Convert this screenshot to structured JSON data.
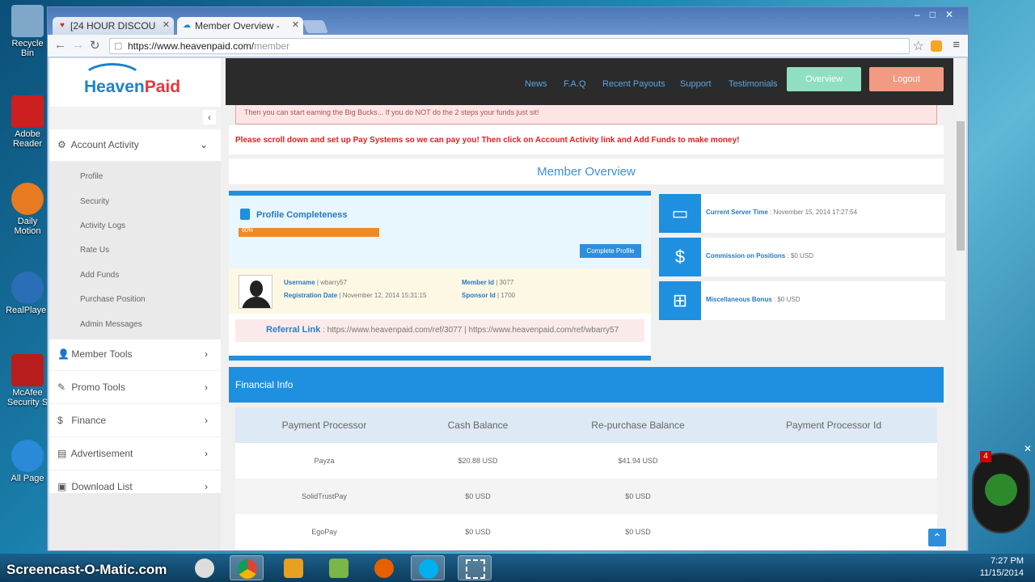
{
  "desktop": {
    "icons": [
      {
        "label": "Recycle Bin",
        "color": "#7fa7c9"
      },
      {
        "label": "Adobe Reader",
        "color": "#cc1f1f"
      },
      {
        "label": "Daily Motion",
        "color": "#e87a1f"
      },
      {
        "label": "RealPlayer",
        "color": "#2a6fb5"
      },
      {
        "label": "McAfee Security S",
        "color": "#b81d1d"
      },
      {
        "label": "All Page",
        "color": "#2a8ad8"
      }
    ]
  },
  "browser": {
    "tabs": [
      {
        "label": "[24 HOUR DISCOU",
        "icon": "heart-icon"
      },
      {
        "label": "Member Overview - ",
        "icon": "heavenpaid-favicon"
      }
    ],
    "url_host": "https://www.heavenpaid.com/",
    "url_path": "member"
  },
  "site": {
    "logo_a": "Heaven",
    "logo_b": "Paid",
    "nav": [
      "News",
      "F.A.Q",
      "Recent Payouts",
      "Support",
      "Testimonials"
    ],
    "overview_btn": "Overview",
    "logout_btn": "Logout"
  },
  "sidebar": {
    "collapse_arrow": "‹",
    "account_activity": "Account Activity",
    "submenu": [
      "Profile",
      "Security",
      "Activity Logs",
      "Rate Us",
      "Add Funds",
      "Purchase Position",
      "Admin Messages"
    ],
    "items": [
      "Member Tools",
      "Promo Tools",
      "Finance",
      "Advertisement",
      "Download List"
    ]
  },
  "main": {
    "alert_text": "Then you can start earning the Big Bucks... If you do NOT do the 2 steps your funds just sit!",
    "warning": "Please scroll down and set up Pay Systems so we can pay you!  Then click on Account Activity link and Add Funds to make money!",
    "overview_title": "Member Overview",
    "profile": {
      "title": "Profile Completeness",
      "progress_label": "90%",
      "complete_btn": "Complete Profile",
      "username_label": "Username",
      "username": "wbarry57",
      "regdate_label": "Registration Date",
      "regdate": "November 12, 2014 15:31:15",
      "memberid_label": "Member Id",
      "memberid": "3077",
      "sponsorid_label": "Sponsor Id",
      "sponsorid": "1700",
      "referral_label": "Referral Link",
      "referral_1": "https://www.heavenpaid.com/ref/3077",
      "referral_2": "https://www.heavenpaid.com/ref/wbarry57"
    },
    "stats": [
      {
        "label": "Current Server Time",
        "value": "November 15, 2014 17:27:54",
        "icon": "monitor-icon"
      },
      {
        "label": "Commission on Positions",
        "value": "$0 USD",
        "icon": "dollar-hand-icon"
      },
      {
        "label": "Miscellaneous Bonus",
        "value": "$0 USD",
        "icon": "gift-icon"
      }
    ],
    "financial_title": "Financial Info",
    "table": {
      "headers": [
        "Payment Processor",
        "Cash Balance",
        "Re-purchase Balance",
        "Payment Processor Id"
      ],
      "rows": [
        [
          "Payza",
          "$20.88 USD",
          "$41.94 USD",
          ""
        ],
        [
          "SolidTrustPay",
          "$0 USD",
          "$0 USD",
          ""
        ],
        [
          "EgoPay",
          "$0 USD",
          "$0 USD",
          ""
        ]
      ]
    }
  },
  "taskbar": {
    "watermark": "Screencast-O-Matic.com",
    "time": "7:27 PM",
    "date": "11/15/2014"
  },
  "gadget": {
    "badge": "4"
  }
}
